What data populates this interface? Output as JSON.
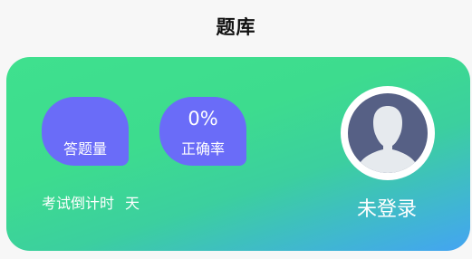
{
  "header": {
    "title": "题库"
  },
  "stats": {
    "answered_label": "答题量",
    "answered_value": "",
    "accuracy_value": "0%",
    "accuracy_label": "正确率"
  },
  "countdown": {
    "label": "考试倒计时",
    "unit": "天"
  },
  "user": {
    "status": "未登录",
    "avatar_icon": "default-user-avatar-icon"
  },
  "colors": {
    "gradient_start": "#3fe08e",
    "gradient_end": "#44a4f2",
    "stat_bubble": "#6a6cf8",
    "avatar_bg": "#566085"
  }
}
